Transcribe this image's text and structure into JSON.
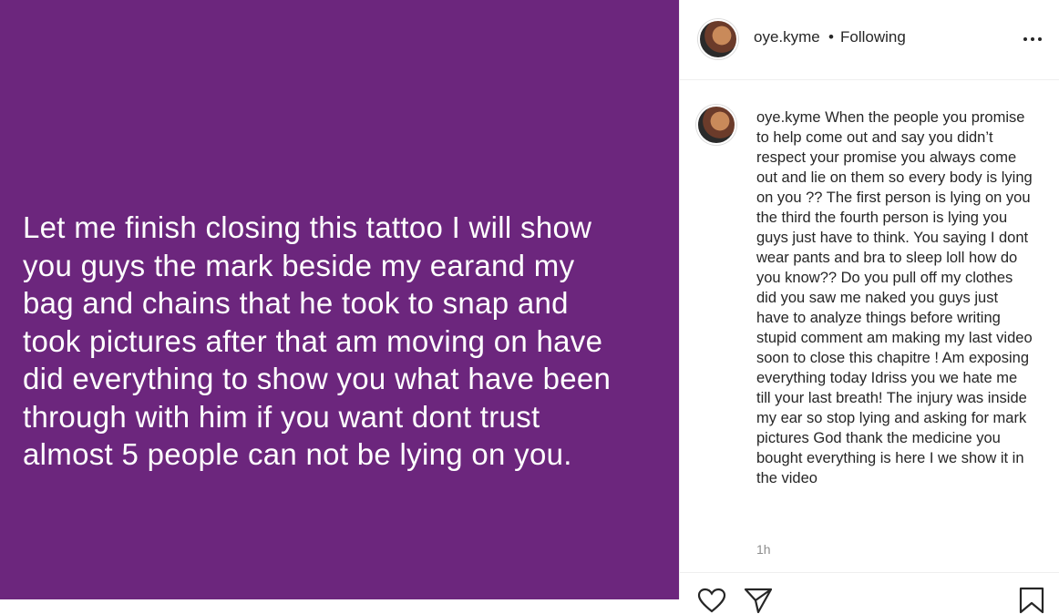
{
  "post": {
    "image_text": "Let me finish closing this tattoo I will show\nyou guys the mark beside my earand my\nbag and chains that he took to snap and\ntook pictures after that am moving on have\ndid everything to show you what have been\nthrough with him if you want dont trust\nalmost 5 people can not be lying on you.",
    "background_color": "#6c267d"
  },
  "header": {
    "username": "oye.kyme",
    "separator": "•",
    "follow_status": "Following",
    "more_icon": "more-horizontal-icon"
  },
  "caption": {
    "username": "oye.kyme",
    "text": "When the people you promise to help come out and say you didn’t respect your promise you always come out and lie on them so every body is lying on you ?? The first person is lying on you the third the fourth person is lying you guys just have to think. You saying I dont wear pants and bra to sleep loll how do you know?? Do you pull off my clothes did you saw me naked you guys just have to analyze things before writing stupid comment am making my last video soon to close this chapitre ! Am exposing everything today Idriss you we hate me till your last breath! The injury was inside my ear so stop lying and asking for mark pictures God thank the medicine you bought everything is here I we show it in the video",
    "timestamp": "1h"
  },
  "actions": {
    "like_icon": "heart-icon",
    "share_icon": "paper-plane-icon",
    "save_icon": "bookmark-icon"
  }
}
